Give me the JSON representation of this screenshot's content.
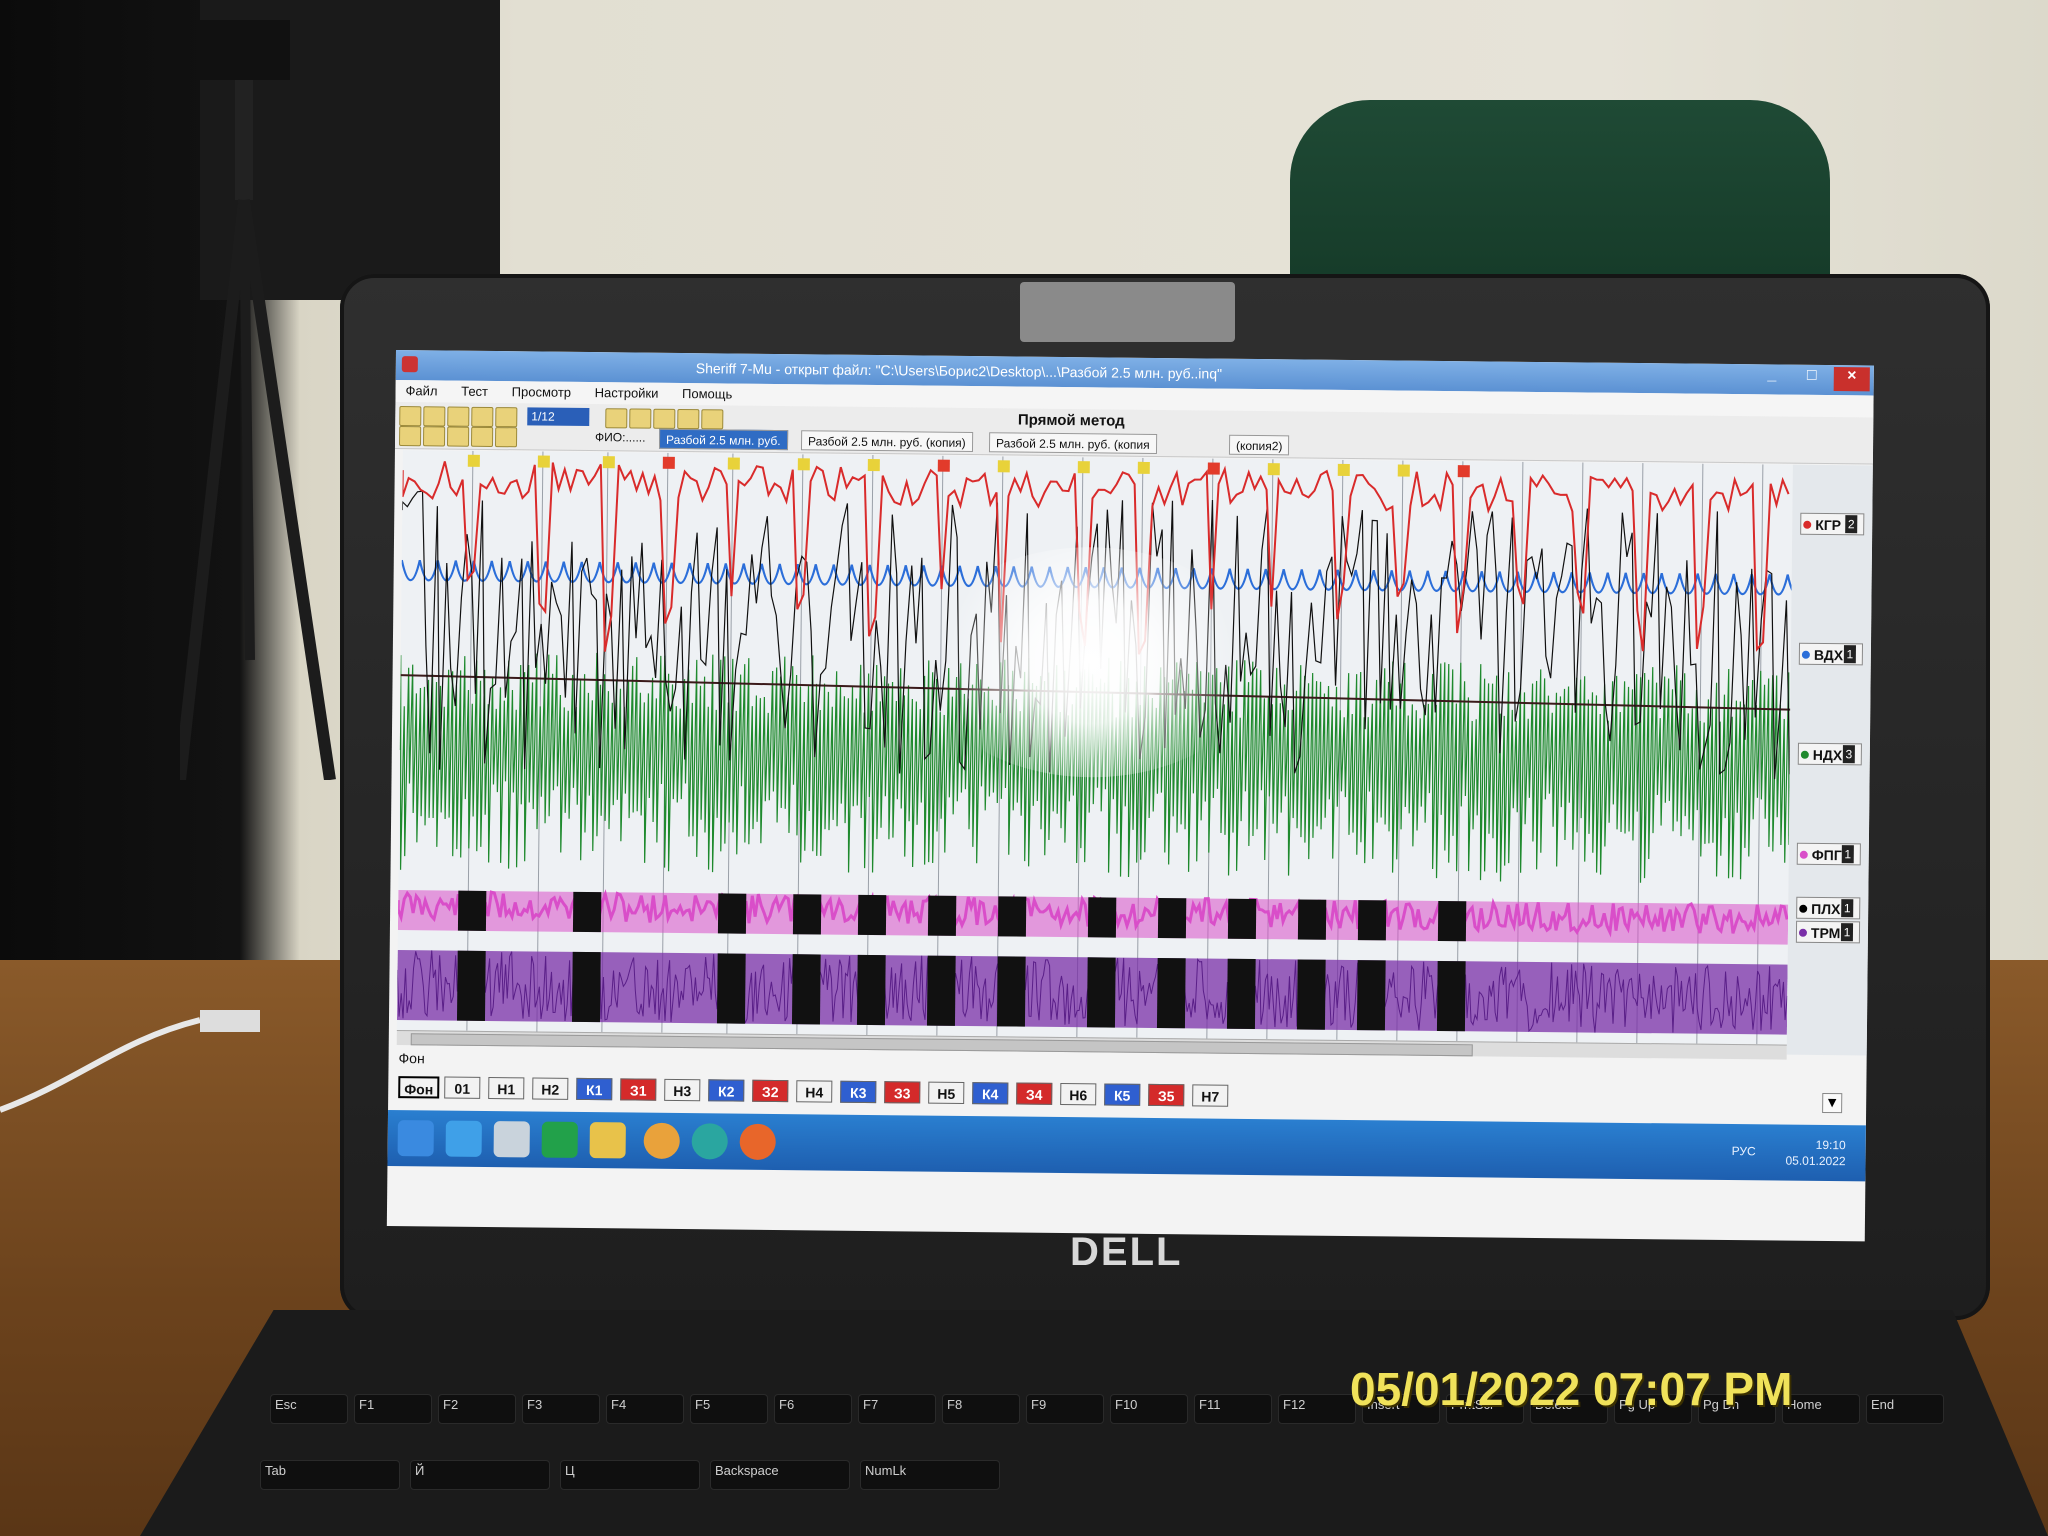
{
  "window": {
    "title": "Sheriff 7-Mu - открыт файл: \"C:\\Users\\Борис2\\Desktop\\...\\Разбой 2.5 млн. руб..inq\"",
    "controls": {
      "minimize": "_",
      "maximize": "□",
      "close": "×"
    }
  },
  "menu": [
    "Файл",
    "Тест",
    "Просмотр",
    "Настройки",
    "Помощь"
  ],
  "toolbar": {
    "scale_value": "1/12",
    "method_label": "Прямой метод",
    "fio_label": "ФИО:......",
    "tabs": [
      {
        "label": "Разбой 2.5 млн. руб.",
        "active": true
      },
      {
        "label": "Разбой 2.5 млн. руб. (копия)",
        "active": false
      },
      {
        "label": "Разбой 2.5 млн. руб. (копия",
        "active": false
      },
      {
        "label": "(копия2)",
        "active": false
      }
    ]
  },
  "channels": [
    {
      "label": "КГР",
      "number": "2",
      "color": "#d92b2b"
    },
    {
      "label": "ВДХ",
      "number": "1",
      "color": "#2b6ed9"
    },
    {
      "label": "НДХ",
      "number": "3",
      "color": "#1f8a2e"
    },
    {
      "label": "ФПГ",
      "number": "1",
      "color": "#d94fc9"
    },
    {
      "label": "ПЛХ",
      "number": "1",
      "color": "#000000"
    },
    {
      "label": "ТРМ",
      "number": "1",
      "color": "#7a2fa8"
    }
  ],
  "background_segment_label": "Фон",
  "questions": [
    {
      "label": "Фон",
      "kind": "n",
      "selected": true
    },
    {
      "label": "01",
      "kind": "n"
    },
    {
      "label": "Н1",
      "kind": "n"
    },
    {
      "label": "Н2",
      "kind": "n"
    },
    {
      "label": "К1",
      "kind": "k"
    },
    {
      "label": "З1",
      "kind": "z"
    },
    {
      "label": "Н3",
      "kind": "n"
    },
    {
      "label": "К2",
      "kind": "k"
    },
    {
      "label": "З2",
      "kind": "z"
    },
    {
      "label": "Н4",
      "kind": "n"
    },
    {
      "label": "К3",
      "kind": "k"
    },
    {
      "label": "З3",
      "kind": "z"
    },
    {
      "label": "Н5",
      "kind": "n"
    },
    {
      "label": "К4",
      "kind": "k"
    },
    {
      "label": "З4",
      "kind": "z"
    },
    {
      "label": "Н6",
      "kind": "n"
    },
    {
      "label": "К5",
      "kind": "k"
    },
    {
      "label": "З5",
      "kind": "z"
    },
    {
      "label": "Н7",
      "kind": "n"
    }
  ],
  "question_dropdown": "▼",
  "taskbar": {
    "apps": [
      "windows-start",
      "internet-explorer",
      "sheriff-app",
      "store",
      "file-explorer",
      "chrome",
      "edge",
      "firefox"
    ],
    "language": "РУС",
    "time": "19:10",
    "date": "05.01.2022"
  },
  "laptop_brand": "DELL",
  "camera_timestamp": "05/01/2022 07:07 PM",
  "keyboard_keys": [
    "Esc",
    "F1",
    "F2",
    "F3",
    "F4",
    "F5",
    "F6",
    "F7",
    "F8",
    "F9",
    "F10",
    "F11",
    "F12",
    "Insert",
    "PrntScr",
    "Delete",
    "Pg Up",
    "Pg Dn",
    "Home",
    "End",
    "Tab",
    "Й",
    "Ц",
    "Backspace",
    "NumLk"
  ]
}
